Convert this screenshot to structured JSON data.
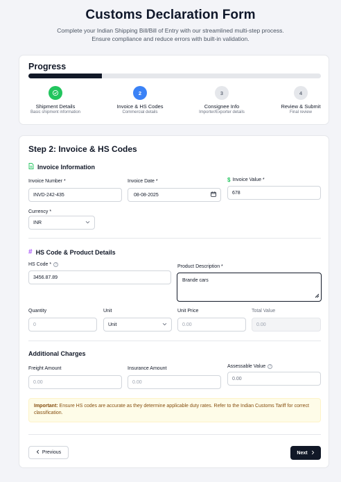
{
  "header": {
    "title": "Customs Declaration Form",
    "subtitle_line1": "Complete your Indian Shipping Bill/Bill of Entry with our streamlined multi-step process.",
    "subtitle_line2": "Ensure compliance and reduce errors with built-in validation."
  },
  "progress": {
    "title": "Progress",
    "percent": 25,
    "steps": [
      {
        "number": "",
        "label": "Shipment Details",
        "sub": "Basic shipment information",
        "state": "done"
      },
      {
        "number": "2",
        "label": "Invoice & HS Codes",
        "sub": "Commercial details",
        "state": "active"
      },
      {
        "number": "3",
        "label": "Consignee Info",
        "sub": "Importer/Exporter details",
        "state": "pending"
      },
      {
        "number": "4",
        "label": "Review & Submit",
        "sub": "Final review",
        "state": "pending"
      }
    ]
  },
  "form": {
    "heading": "Step 2: Invoice & HS Codes",
    "invoice_section": {
      "title": "Invoice Information",
      "invoice_number_label": "Invoice Number *",
      "invoice_number_value": "INVD-242-435",
      "invoice_date_label": "Invoice Date *",
      "invoice_date_value": "08-08-2025",
      "invoice_value_label": "Invoice Value *",
      "invoice_value_value": "678",
      "currency_label": "Currency *",
      "currency_value": "INR"
    },
    "hs_section": {
      "title": "HS Code & Product Details",
      "hs_code_label": "HS Code *",
      "hs_code_value": "3456.87.89",
      "description_label": "Product Description *",
      "description_value": "Brande cars",
      "quantity_label": "Quantity",
      "quantity_placeholder": "0",
      "unit_label": "Unit",
      "unit_value": "Unit",
      "unit_price_label": "Unit Price",
      "unit_price_placeholder": "0.00",
      "total_value_label": "Total Value",
      "total_value_value": "0.00"
    },
    "charges_section": {
      "title": "Additional Charges",
      "freight_label": "Freight Amount",
      "freight_placeholder": "0.00",
      "insurance_label": "Insurance Amount",
      "insurance_placeholder": "0.00",
      "assessable_label": "Assessable Value",
      "assessable_value": "0.00"
    },
    "note": {
      "bold": "Important:",
      "text": " Ensure HS codes are accurate as they determine applicable duty rates. Refer to the Indian Customs Tariff for correct classification."
    },
    "prev_label": "Previous",
    "next_label": "Next"
  },
  "colors": {
    "done": "#22c55e",
    "active": "#3b82f6",
    "primary": "#111827",
    "note_bg": "#fefce8"
  }
}
